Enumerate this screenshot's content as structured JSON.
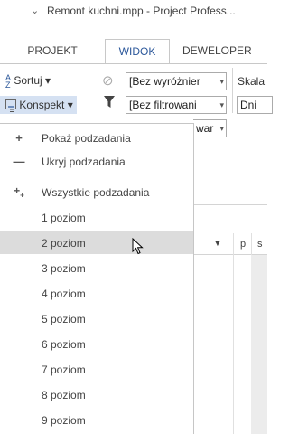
{
  "titlebar": {
    "qa_glyph": "⌄",
    "title": "Remont kuchni.mpp - Project Profess..."
  },
  "tabs": [
    {
      "label": "PROJEKT",
      "active": false
    },
    {
      "label": "WIDOK",
      "active": true
    },
    {
      "label": "DEWELOPER",
      "active": false
    }
  ],
  "ribbon": {
    "sort_label": "Sortuj ▾",
    "outline_label": "Konspekt ▾",
    "highlight_combo": "[Bez wyróżnier",
    "filter_combo": "[Bez filtrowani",
    "group_combo": "war",
    "scale_label": "Skala",
    "scale_combo": "Dni"
  },
  "gantt": {
    "letters": [
      "p",
      "s"
    ]
  },
  "menu": {
    "items": [
      {
        "icon": "plus-icon",
        "glyph": "+",
        "label": "Pokaż podzadania"
      },
      {
        "icon": "minus-icon",
        "glyph": "−",
        "label": "Ukryj podzadania"
      },
      {
        "icon": "all-subtasks-icon",
        "glyph": "⁺",
        "label": "Wszystkie podzadania"
      },
      {
        "icon": "",
        "glyph": "",
        "label": "1 poziom"
      },
      {
        "icon": "",
        "glyph": "",
        "label": "2 poziom"
      },
      {
        "icon": "",
        "glyph": "",
        "label": "3 poziom"
      },
      {
        "icon": "",
        "glyph": "",
        "label": "4 poziom"
      },
      {
        "icon": "",
        "glyph": "",
        "label": "5 poziom"
      },
      {
        "icon": "",
        "glyph": "",
        "label": "6 poziom"
      },
      {
        "icon": "",
        "glyph": "",
        "label": "7 poziom"
      },
      {
        "icon": "",
        "glyph": "",
        "label": "8 poziom"
      },
      {
        "icon": "",
        "glyph": "",
        "label": "9 poziom"
      }
    ],
    "hovered_index": 4
  },
  "colors": {
    "accent": "#2b579a",
    "hover_bg": "#dcdcdc",
    "outline_highlight": "#d5e1f2"
  }
}
